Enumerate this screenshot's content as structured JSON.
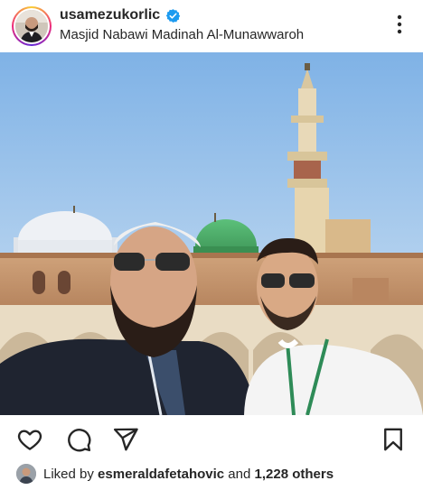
{
  "post": {
    "username": "usamezukorlic",
    "location": "Masjid Nabawi Madinah Al-Munawwaroh",
    "verified_icon": "verified-badge-icon",
    "more_icon": "more-options-icon"
  },
  "photo": {
    "description_icon": "post-photo"
  },
  "actions": {
    "like_icon": "heart-icon",
    "comment_icon": "comment-icon",
    "share_icon": "send-icon",
    "save_icon": "bookmark-icon"
  },
  "likes": {
    "prefix": "Liked by",
    "liker": "esmeraldafetahovic",
    "conjunction": "and",
    "others": "1,228 others"
  },
  "colors": {
    "verified_blue": "#1d9bf0",
    "sky": "#b9d4ee",
    "dome_green": "#3c9a57"
  }
}
